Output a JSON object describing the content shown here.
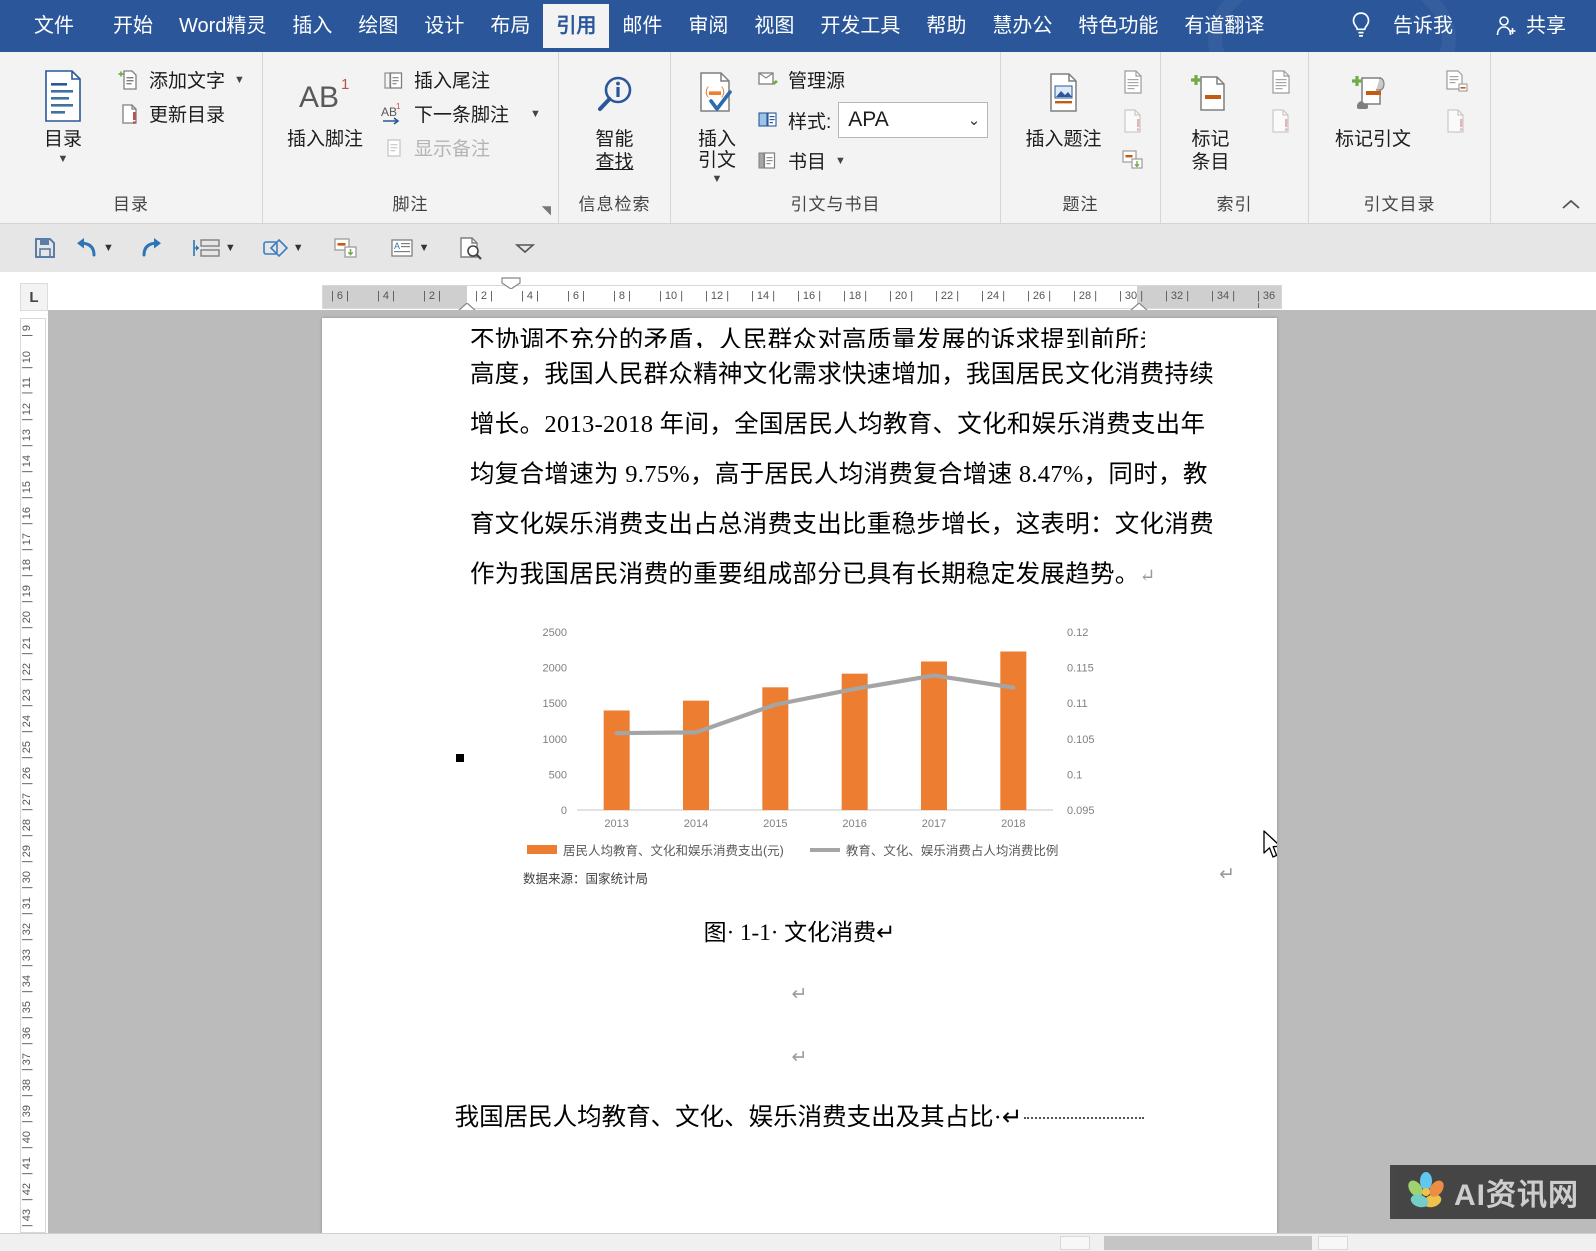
{
  "app": {
    "name": "Microsoft Word",
    "accent_color": "#2b579a",
    "ribbon_bg": "#f3f3f3"
  },
  "menubar": {
    "items": [
      {
        "label": "文件",
        "active": false
      },
      {
        "label": "开始",
        "active": false
      },
      {
        "label": "Word精灵",
        "active": false
      },
      {
        "label": "插入",
        "active": false
      },
      {
        "label": "绘图",
        "active": false
      },
      {
        "label": "设计",
        "active": false
      },
      {
        "label": "布局",
        "active": false
      },
      {
        "label": "引用",
        "active": true
      },
      {
        "label": "邮件",
        "active": false
      },
      {
        "label": "审阅",
        "active": false
      },
      {
        "label": "视图",
        "active": false
      },
      {
        "label": "开发工具",
        "active": false
      },
      {
        "label": "帮助",
        "active": false
      },
      {
        "label": "慧办公",
        "active": false
      },
      {
        "label": "特色功能",
        "active": false
      },
      {
        "label": "有道翻译",
        "active": false
      }
    ],
    "tell_me": "告诉我",
    "share": "共享"
  },
  "ribbon": {
    "groups": [
      {
        "name": "目录",
        "label": "目录",
        "big_button": {
          "label": "目录",
          "icon": "toc-icon",
          "has_caret": true
        },
        "small_buttons": [
          {
            "label": "添加文字",
            "icon": "add-text-icon",
            "has_caret": true,
            "disabled": false
          },
          {
            "label": "更新目录",
            "icon": "update-toc-icon",
            "has_caret": false,
            "disabled": false
          }
        ]
      },
      {
        "name": "脚注",
        "label": "脚注",
        "big_button": {
          "label": "插入脚注",
          "icon": "insert-footnote-icon",
          "glyph": "AB",
          "sup": "1",
          "has_caret": false
        },
        "small_buttons": [
          {
            "label": "插入尾注",
            "icon": "insert-endnote-icon",
            "has_caret": false,
            "disabled": false
          },
          {
            "label": "下一条脚注",
            "icon": "next-footnote-icon",
            "has_caret": true,
            "disabled": false
          },
          {
            "label": "显示备注",
            "icon": "show-notes-icon",
            "has_caret": false,
            "disabled": true
          }
        ],
        "has_dialog_launcher": true
      },
      {
        "name": "信息检索",
        "label": "信息检索",
        "big_button": {
          "label": "智能\n查找",
          "label_line1": "智能",
          "label_line2": "查找",
          "icon": "smart-lookup-icon",
          "has_caret": false
        }
      },
      {
        "name": "引文与书目",
        "label": "引文与书目",
        "big_button": {
          "label": "插入引文",
          "icon": "insert-citation-icon",
          "has_caret": true
        },
        "small_buttons": [
          {
            "label": "管理源",
            "icon": "manage-sources-icon",
            "has_caret": false,
            "disabled": false
          },
          {
            "label": "书目",
            "icon": "bibliography-icon",
            "has_caret": true,
            "disabled": false
          }
        ],
        "style_field": {
          "label": "样式:",
          "value": "APA",
          "icon": "style-icon"
        }
      },
      {
        "name": "题注",
        "label": "题注",
        "big_button": {
          "label": "插入题注",
          "icon": "insert-caption-icon",
          "has_caret": false
        },
        "stack_icons": [
          "insert-table-of-figures-icon",
          "update-table-icon",
          "cross-reference-icon"
        ]
      },
      {
        "name": "索引",
        "label": "索引",
        "big_button": {
          "label_line1": "标记",
          "label_line2": "条目",
          "label": "标记条目",
          "icon": "mark-entry-icon",
          "has_caret": false
        },
        "stack_icons": [
          "insert-index-icon",
          "update-index-icon"
        ]
      },
      {
        "name": "引文目录",
        "label": "引文目录",
        "big_button": {
          "label": "标记引文",
          "icon": "mark-citation-icon",
          "has_caret": false
        },
        "stack_icons": [
          "insert-table-of-authorities-icon",
          "update-table-of-authorities-icon"
        ]
      }
    ],
    "collapse_label": "^"
  },
  "quick_access_toolbar": {
    "items": [
      {
        "name": "save-icon",
        "has_caret": false
      },
      {
        "name": "undo-icon",
        "has_caret": true
      },
      {
        "name": "redo-icon",
        "has_caret": false
      },
      {
        "name": "paragraph-spacing-icon",
        "has_caret": true
      },
      {
        "name": "shapes-merge-icon",
        "has_caret": true
      },
      {
        "name": "cross-reference-icon",
        "has_caret": false
      },
      {
        "name": "text-box-icon",
        "has_caret": true
      },
      {
        "name": "print-preview-icon",
        "has_caret": false
      },
      {
        "name": "customize-qat-icon",
        "has_caret": false
      }
    ]
  },
  "rulers": {
    "horizontal_ticks": [
      "6",
      "4",
      "2",
      "2",
      "4",
      "6",
      "8",
      "10",
      "12",
      "14",
      "16",
      "18",
      "20",
      "22",
      "24",
      "26",
      "28",
      "30",
      "32",
      "34",
      "36"
    ],
    "vertical_ticks": [
      "9",
      "10",
      "11",
      "12",
      "13",
      "14",
      "15",
      "16",
      "17",
      "18",
      "19",
      "20",
      "21",
      "22",
      "23",
      "24",
      "25",
      "26",
      "27",
      "28",
      "29",
      "30",
      "31",
      "32",
      "33",
      "34",
      "35",
      "36",
      "37",
      "38",
      "39",
      "40",
      "41",
      "42",
      "43"
    ],
    "corner_tab": "L"
  },
  "document": {
    "paragraph_lines": [
      "不协调不充分的矛盾，人民群众对高质量发展的诉求提到前所未有的",
      "高度，我国人民群众精神文化需求快速增加，我国居民文化消费持续",
      "增长。2013-2018 年间，全国居民人均教育、文化和娱乐消费支出年",
      "均复合增速为 9.75%，高于居民人均消费复合增速 8.47%，同时，教",
      "育文化娱乐消费支出占总消费支出比重稳步增长，这表明：文化消费",
      "作为我国居民消费的重要组成部分已具有长期稳定发展趋势。"
    ],
    "paragraph_end_mark": "↵",
    "figure_caption": "图· 1-1· 文化消费↵",
    "empty_paragraph_mark": "↵",
    "bottom_heading": "我国居民人均教育、文化、娱乐消费支出及其占比·↵",
    "data_source_note": "数据来源：国家统计局"
  },
  "chart_data": {
    "type": "bar",
    "title": "",
    "subtitle": "",
    "xlabel": "",
    "ylabel": "",
    "categories": [
      "2013",
      "2014",
      "2015",
      "2016",
      "2017",
      "2018"
    ],
    "series": [
      {
        "name": "居民人均教育、文化和娱乐消费支出(元)",
        "type": "bar",
        "color": "#ED7D31",
        "axis": "left",
        "values": [
          1398,
          1536,
          1723,
          1915,
          2086,
          2226
        ]
      },
      {
        "name": "教育、文化、娱乐消费占人均消费比例",
        "type": "line",
        "color": "#A5A5A5",
        "axis": "right",
        "values": [
          0.1058,
          0.1059,
          0.1098,
          0.112,
          0.1139,
          0.1122
        ]
      }
    ],
    "ylim": [
      0,
      2500
    ],
    "yticks": [
      "0",
      "500",
      "1000",
      "1500",
      "2000",
      "2500"
    ],
    "y2lim": [
      0.095,
      0.12
    ],
    "y2ticks": [
      "0.095",
      "0.1",
      "0.105",
      "0.11",
      "0.115",
      "0.12"
    ],
    "legend_position": "bottom",
    "grid": false,
    "source": "数据来源：国家统计局"
  },
  "watermark": {
    "text": "AI资讯网",
    "logo": "flower-logo-icon"
  }
}
